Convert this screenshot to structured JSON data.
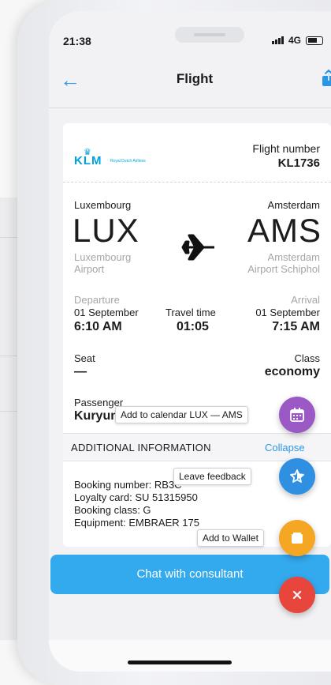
{
  "status": {
    "time": "21:38",
    "network": "4G"
  },
  "nav": {
    "title": "Flight"
  },
  "airline": {
    "name": "KLM",
    "tagline": "Royal Dutch Airlines"
  },
  "flight": {
    "number_label": "Flight number",
    "number": "KL1736",
    "origin": {
      "city": "Luxembourg",
      "code": "LUX",
      "airport_line1": "Luxembourg",
      "airport_line2": "Airport"
    },
    "destination": {
      "city": "Amsterdam",
      "code": "AMS",
      "airport_line1": "Amsterdam",
      "airport_line2": "Airport Schiphol"
    },
    "departure_label": "Departure",
    "departure_date": "01 September",
    "departure_time": "6:10 AM",
    "travel_time_label": "Travel time",
    "travel_time": "01:05",
    "arrival_label": "Arrival",
    "arrival_date": "01 September",
    "arrival_time": "7:15 AM",
    "seat_label": "Seat",
    "seat": "—",
    "class_label": "Class",
    "class": "economy",
    "passenger_label": "Passenger",
    "passenger": "Kuryumo"
  },
  "additional": {
    "title": "ADDITIONAL INFORMATION",
    "collapse": "Collapse",
    "lines": [
      "Booking number: RB3C",
      "Loyalty card: SU 51315950",
      "Booking class: G",
      "Equipment: EMBRAER 175"
    ]
  },
  "actions": {
    "calendar_tip": "Add to calendar LUX — AMS",
    "feedback_tip": "Leave feedback",
    "wallet_tip": "Add to Wallet",
    "chat": "Chat with consultant"
  },
  "colors": {
    "accent": "#2a96e6",
    "calendar_fab": "#9b59c6",
    "feedback_fab": "#2f8fe0",
    "wallet_fab": "#f5a623",
    "close_fab": "#e8453c"
  }
}
